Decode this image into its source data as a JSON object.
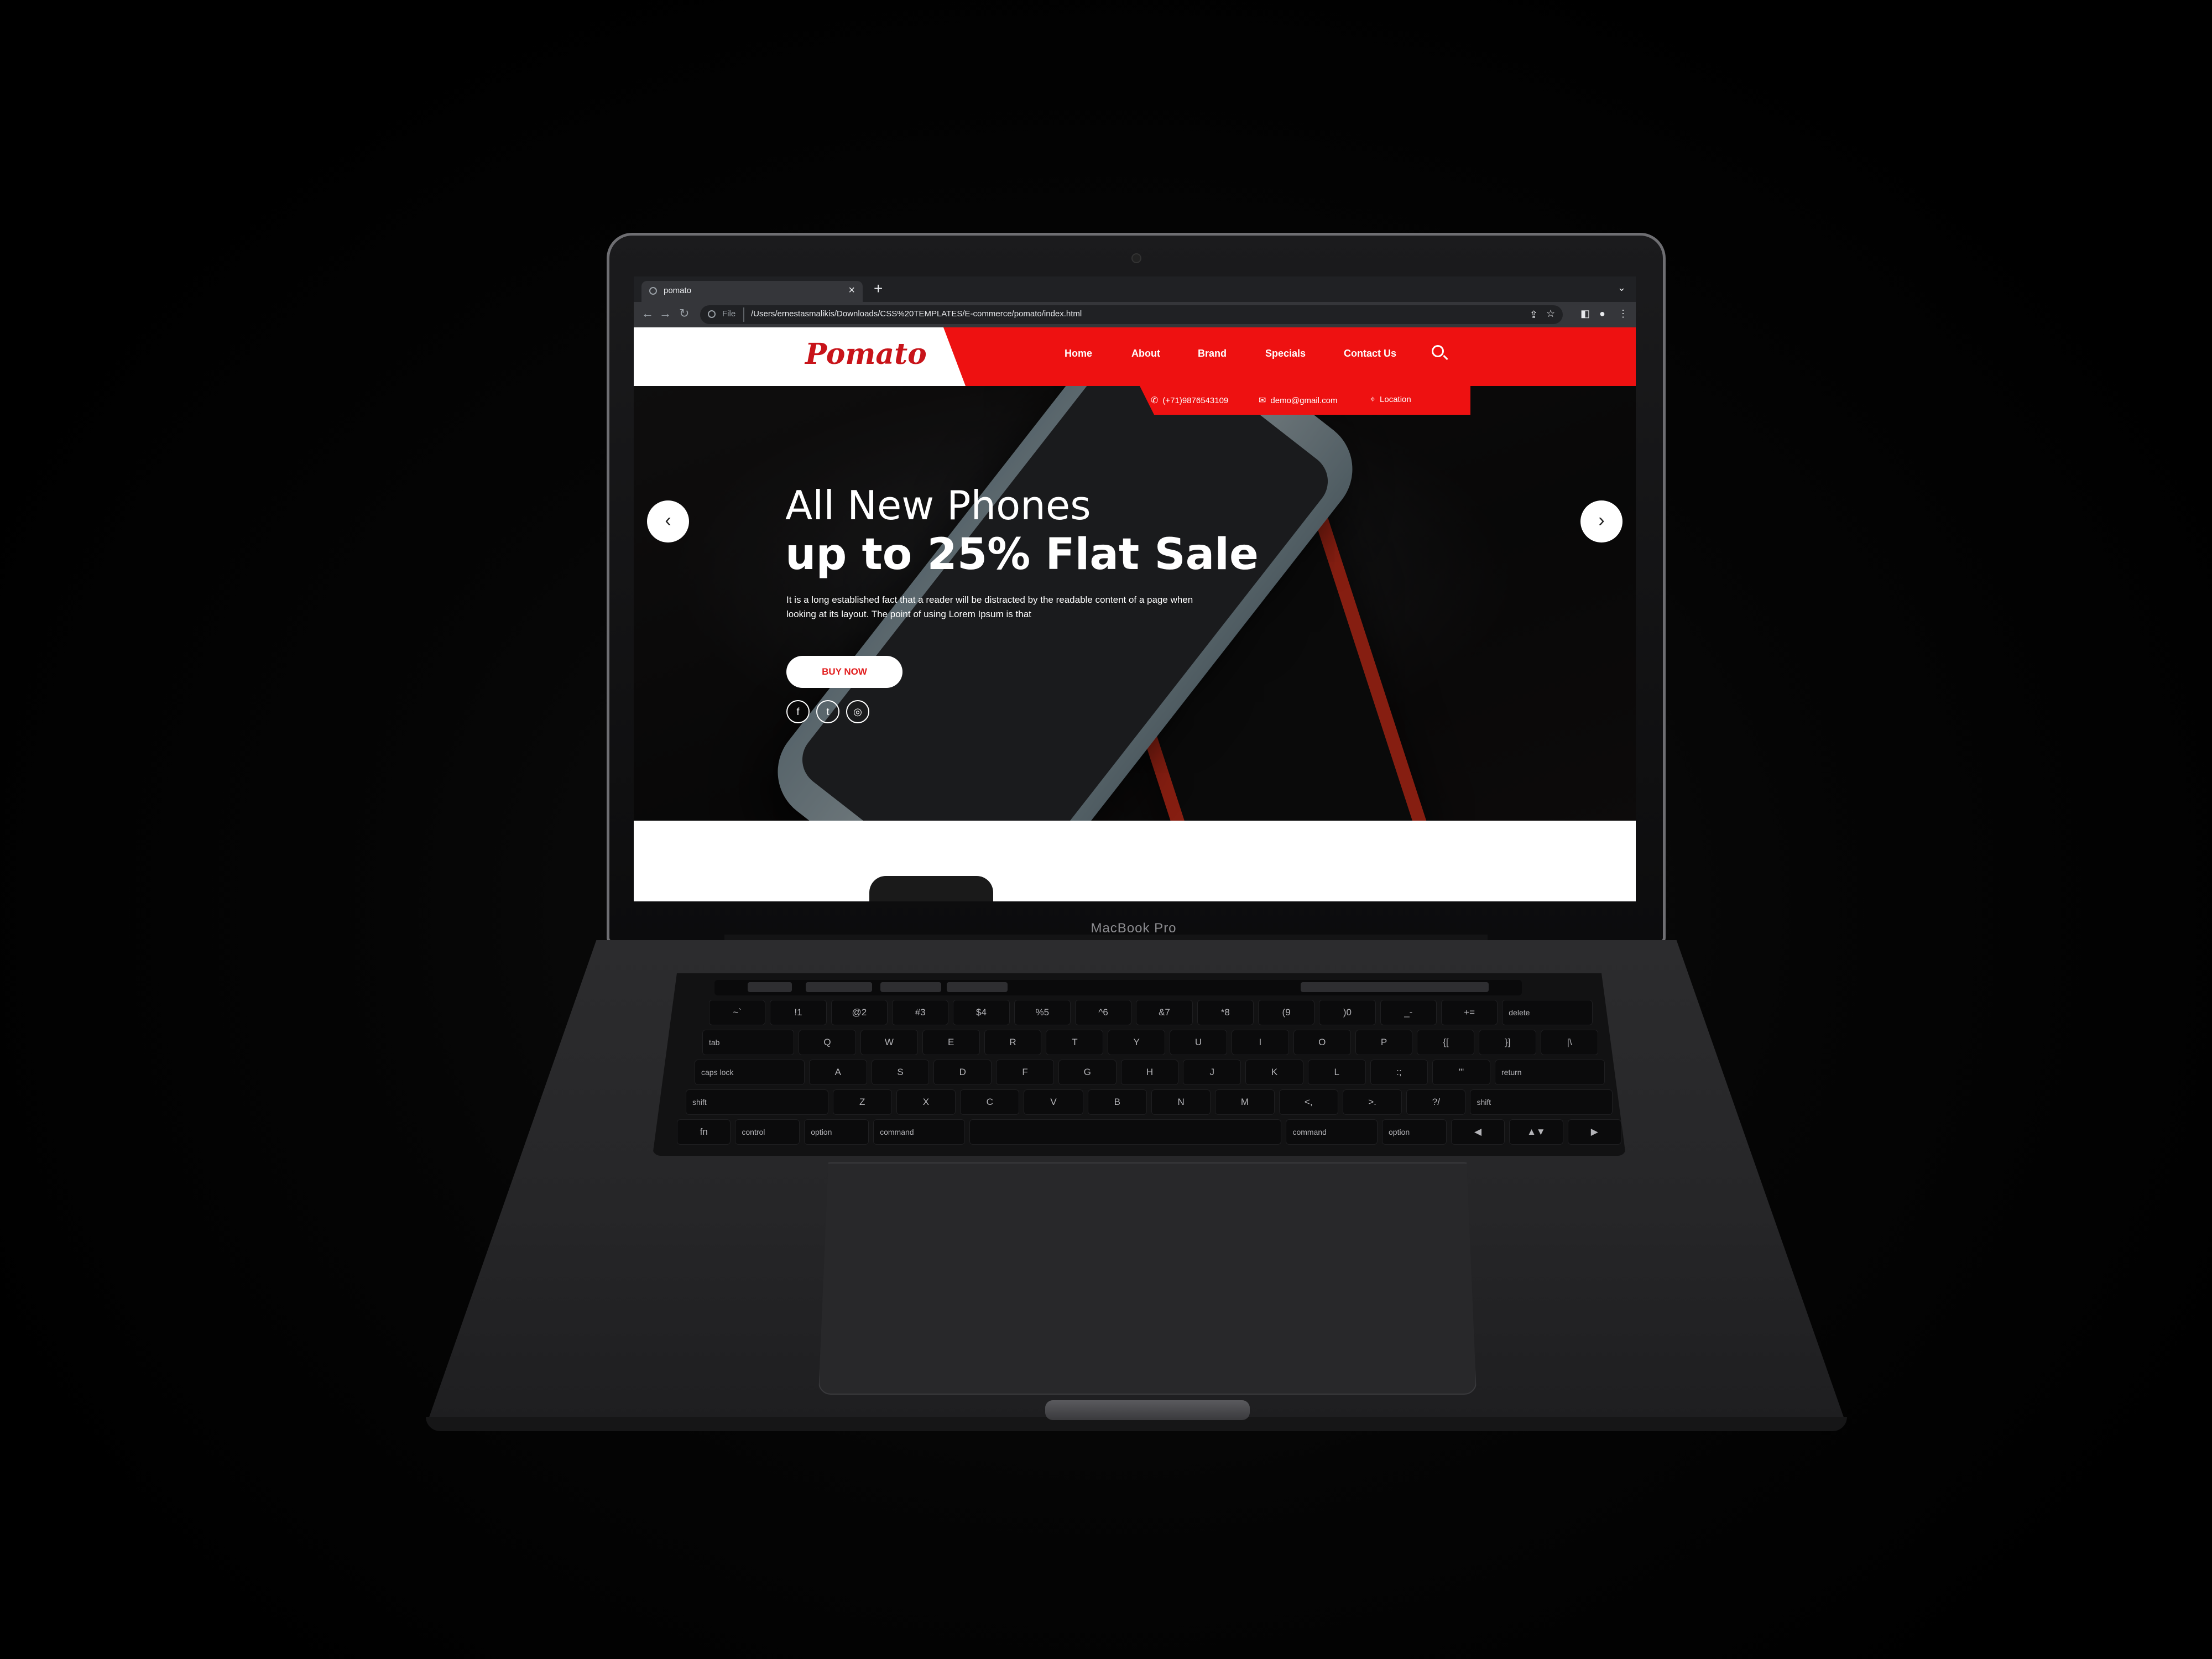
{
  "browser": {
    "tab_title": "pomato",
    "new_tab": "+",
    "tab_close": "×",
    "file_label": "File",
    "url": "/Users/ernestasmalikis/Downloads/CSS%20TEMPLATES/E-commerce/pomato/index.html"
  },
  "site": {
    "logo": "Pomato",
    "nav": [
      "Home",
      "About",
      "Brand",
      "Specials",
      "Contact Us"
    ],
    "contact": {
      "phone": "(+71)9876543109",
      "email": "demo@gmail.com",
      "location": "Location"
    },
    "hero": {
      "title_line1": "All New Phones",
      "title_line2": "up to 25% Flat Sale",
      "description": "It is a long established fact that a reader will be distracted by the readable content of a page when looking at its layout. The point of using Lorem Ipsum is that",
      "button": "BUY NOW",
      "social": [
        "f",
        "t",
        "◎"
      ],
      "prev": "‹",
      "next": "›"
    }
  },
  "device": {
    "label": "MacBook Pro"
  },
  "keyboard": {
    "row1": [
      "~`",
      "!1",
      "@2",
      "#3",
      "$4",
      "%5",
      "^6",
      "&7",
      "*8",
      "(9",
      ")0",
      "_-",
      "+=",
      "delete"
    ],
    "row2": [
      "tab",
      "Q",
      "W",
      "E",
      "R",
      "T",
      "Y",
      "U",
      "I",
      "O",
      "P",
      "{[",
      "}]",
      "|\\"
    ],
    "row3": [
      "caps lock",
      "A",
      "S",
      "D",
      "F",
      "G",
      "H",
      "J",
      "K",
      "L",
      ":;",
      "\"'",
      "return"
    ],
    "row4": [
      "shift",
      "Z",
      "X",
      "C",
      "V",
      "B",
      "N",
      "M",
      "<,",
      ">.",
      "?/",
      "shift"
    ],
    "row5": [
      "fn",
      "control",
      "option",
      "command",
      "",
      "command",
      "option",
      "◀",
      "▲▼",
      "▶"
    ]
  },
  "colors": {
    "brand_red": "#ee1111",
    "logo_red": "#c8141a"
  }
}
